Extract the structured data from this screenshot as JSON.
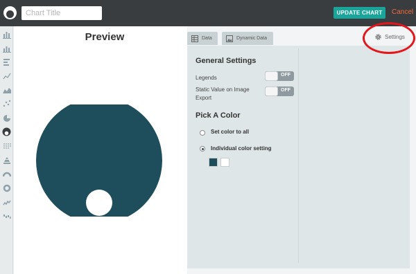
{
  "header": {
    "title_placeholder": "Chart Title",
    "title_value": "",
    "update_button_label": "UPDATE CHART",
    "cancel_label": "Cancel"
  },
  "sidebar": {
    "items": [
      {
        "icon": "bar-chart-icon"
      },
      {
        "icon": "stacked-bar-chart-icon"
      },
      {
        "icon": "horizontal-bar-chart-icon"
      },
      {
        "icon": "line-chart-icon"
      },
      {
        "icon": "area-chart-icon"
      },
      {
        "icon": "scatter-chart-icon"
      },
      {
        "icon": "pie-chart-icon"
      },
      {
        "icon": "partial-circle-chart-icon",
        "active": true
      },
      {
        "icon": "dot-grid-chart-icon"
      },
      {
        "icon": "pyramid-chart-icon"
      },
      {
        "icon": "semicircle-chart-icon"
      },
      {
        "icon": "donut-chart-icon"
      },
      {
        "icon": "sparkline-chart-icon"
      },
      {
        "icon": "waterfall-chart-icon"
      }
    ]
  },
  "preview": {
    "title": "Preview",
    "chart_color": "#1e4d5b",
    "secondary_color": "#ffffff"
  },
  "tabs": [
    {
      "label": "Data",
      "icon": "table-icon"
    },
    {
      "label": "Dynamic Data",
      "icon": "image-icon"
    }
  ],
  "settings_tab": {
    "label": "Settings",
    "icon": "gear-icon"
  },
  "general_settings": {
    "heading": "General Settings",
    "legends_label": "Legends",
    "legends_toggle": "OFF",
    "static_value_label_line1": "Static Value on Image",
    "static_value_label_line2": "Export",
    "static_value_toggle": "OFF"
  },
  "pick_color": {
    "heading": "Pick A Color",
    "option_all": "Set color to all",
    "option_individual": "Individual color setting",
    "selected_option": "Individual color setting",
    "swatches": [
      "#1e4d5b",
      "#ffffff"
    ]
  },
  "colors": {
    "topbar": "#3a3d40",
    "accent": "#1aa59b",
    "cancel": "#f06a3a",
    "highlight": "#e3161b"
  }
}
